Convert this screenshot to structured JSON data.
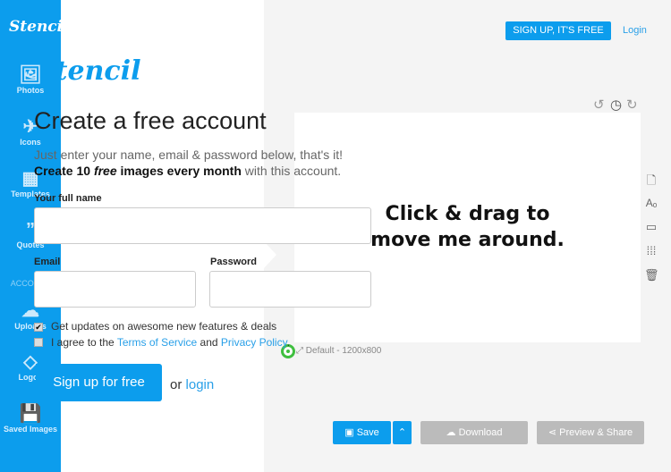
{
  "sidebar": {
    "logo": "Stencil",
    "items": [
      {
        "label": "Photos",
        "icon": "photos-icon"
      },
      {
        "label": "Icons",
        "icon": "origami-bird-icon"
      },
      {
        "label": "Templates",
        "icon": "templates-icon"
      },
      {
        "label": "Quotes",
        "icon": "quote-icon"
      },
      {
        "label": "ACCOUNT"
      },
      {
        "label": "Uploads",
        "icon": "cloud-upload-icon"
      },
      {
        "label": "Logos",
        "icon": "paint-bucket-icon"
      },
      {
        "label": "Saved Images",
        "icon": "saved-images-icon"
      }
    ]
  },
  "modal": {
    "logo": "Stencil",
    "title": "Create a free account",
    "subtitle": "Just enter your name, email & password below, that's it!",
    "promo_strong1": "Create 10 ",
    "promo_em": "free",
    "promo_strong2": " images every month",
    "promo_rest": " with this account.",
    "name_label": "Your full name",
    "email_label": "Email",
    "password_label": "Password",
    "updates_label": "Get updates on awesome new features & deals",
    "updates_checked": true,
    "agree_pre": "I agree to the ",
    "terms": "Terms of Service",
    "and": " and ",
    "privacy": "Privacy Policy",
    "agree_checked": false,
    "signup_button": "Sign up for free",
    "or": "or ",
    "login": "login"
  },
  "header": {
    "signup_button": "SIGN UP, IT'S FREE",
    "login": "Login"
  },
  "canvas": {
    "text": "Click & drag to move me around.",
    "size_label": "Default - 1200x800"
  },
  "footer": {
    "save": "Save",
    "download": "Download",
    "preview": "Preview & Share"
  },
  "colors": {
    "accent": "#0c9ded",
    "disabled": "#bbbbbb",
    "target": "#3fbf3f"
  }
}
